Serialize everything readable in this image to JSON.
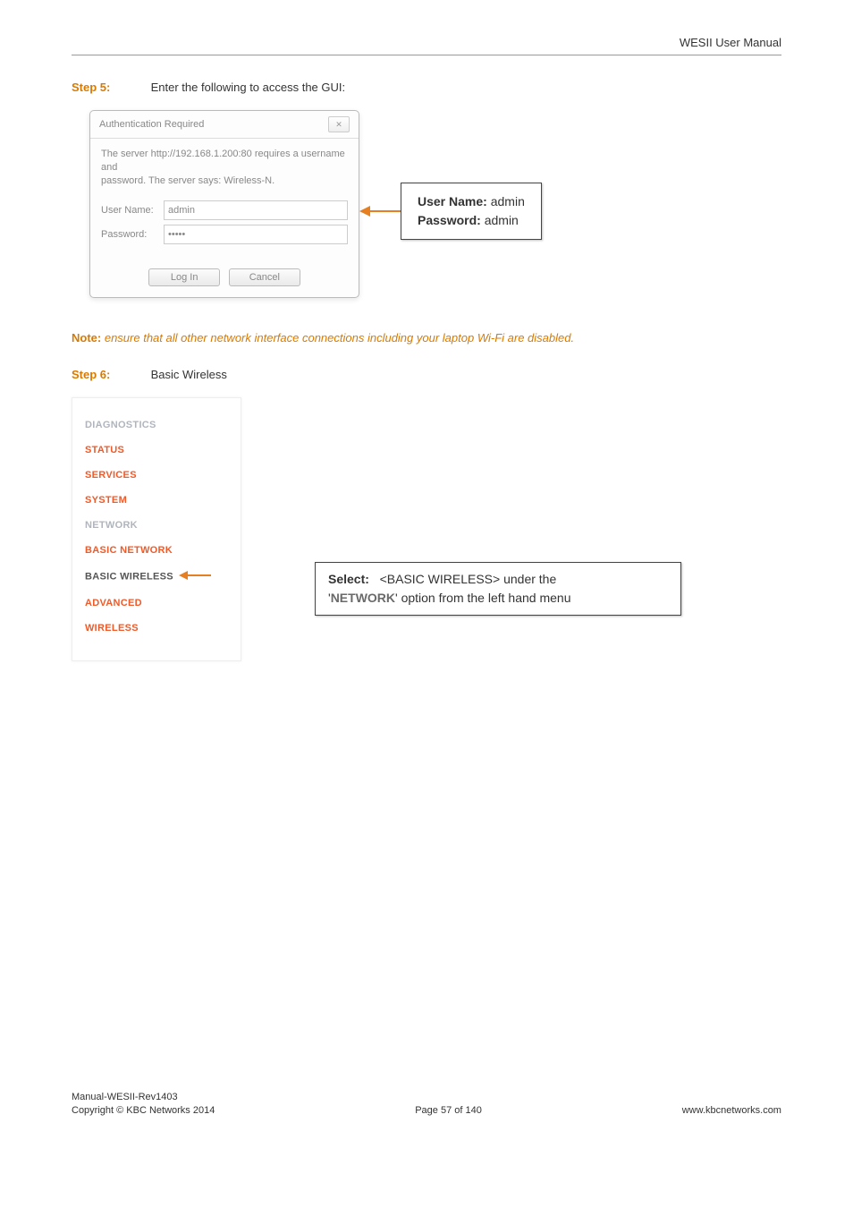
{
  "header": {
    "doc_title": "WESII User Manual"
  },
  "step5": {
    "label": "Step 5:",
    "text": "Enter the following to access the GUI:"
  },
  "dialog": {
    "title": "Authentication Required",
    "close_glyph": "✕",
    "msg_line1": "The server http://192.168.1.200:80 requires a username and",
    "msg_line2": "password. The server says: Wireless-N.",
    "user_label": "User Name:",
    "user_value": "admin",
    "pass_label": "Password:",
    "pass_value": "•••••",
    "login_btn": "Log In",
    "cancel_btn": "Cancel"
  },
  "credentials": {
    "user_label": "User Name:",
    "user_value": "admin",
    "pass_label": "Password:",
    "pass_value": "admin"
  },
  "note": {
    "label": "Note:",
    "text": "ensure that all other network interface connections including your laptop Wi-Fi are disabled."
  },
  "step6": {
    "label": "Step 6:",
    "text": "Basic Wireless"
  },
  "sidebar": {
    "items": [
      {
        "label": "DIAGNOSTICS",
        "cls": "nav-gray"
      },
      {
        "label": "STATUS",
        "cls": "nav-orange"
      },
      {
        "label": "SERVICES",
        "cls": "nav-orange"
      },
      {
        "label": "SYSTEM",
        "cls": "nav-orange"
      },
      {
        "label": "NETWORK",
        "cls": "nav-gray"
      },
      {
        "label": "BASIC NETWORK",
        "cls": "nav-orange"
      },
      {
        "label": "BASIC WIRELESS",
        "cls": "nav-bold",
        "arrow": true
      },
      {
        "label": "ADVANCED",
        "cls": "nav-orange"
      },
      {
        "label": "WIRELESS",
        "cls": "nav-orange"
      }
    ]
  },
  "callout": {
    "select_label": "Select:",
    "select_value": "<BASIC WIRELESS>",
    "tail1": " under the",
    "line2a": "'",
    "network": "NETWORK",
    "line2b": "' option from the left hand menu"
  },
  "footer": {
    "left1": "Manual-WESII-Rev1403",
    "left2": "Copyright © KBC Networks 2014",
    "center": "Page 57 of 140",
    "right": "www.kbcnetworks.com"
  }
}
